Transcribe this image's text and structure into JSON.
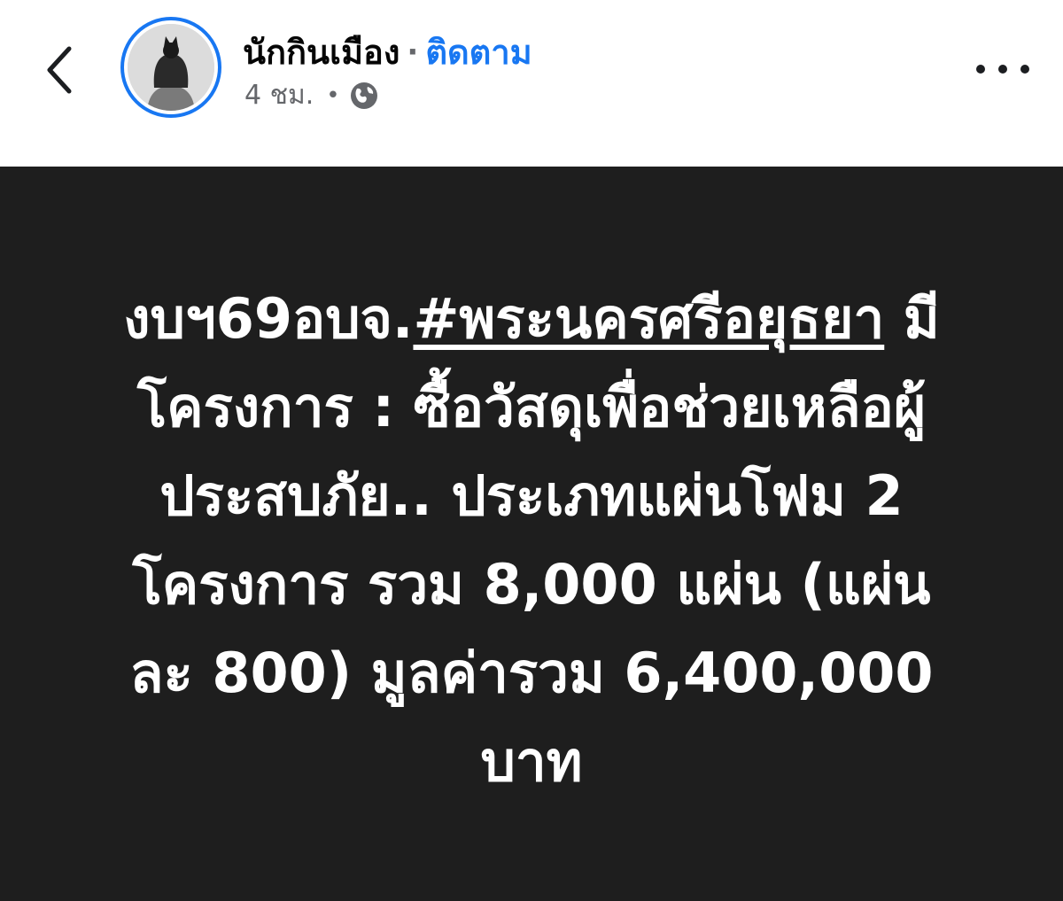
{
  "header": {
    "author_name": "นักกินเมือง",
    "separator": "·",
    "follow_label": "ติดตาม",
    "post_time": "4 ชม.",
    "meta_separator": "•",
    "privacy_icon": "globe-icon",
    "back_icon": "chevron-left-icon",
    "more_icon": "more-horizontal-icon"
  },
  "post": {
    "lines": [
      {
        "before": "งบฯ69อบจ.",
        "hashtag": "#พระนครศรีอยุธยา",
        "after": " มี"
      },
      {
        "text": "โครงการ : ซื้อวัสดุเพื่อช่วยเหลือผู้"
      },
      {
        "text": "ประสบภัย.. ประเภทแผ่นโฟม 2"
      },
      {
        "text": "โครงการ รวม 8,000 แผ่น (แผ่น"
      },
      {
        "text": "ละ 800) มูลค่ารวม 6,400,000"
      },
      {
        "text": "บาท"
      }
    ]
  },
  "colors": {
    "accent": "#1877f2",
    "panel_background": "#1e1e1e",
    "post_text": "#ffffff",
    "secondary_text": "#65676b"
  }
}
